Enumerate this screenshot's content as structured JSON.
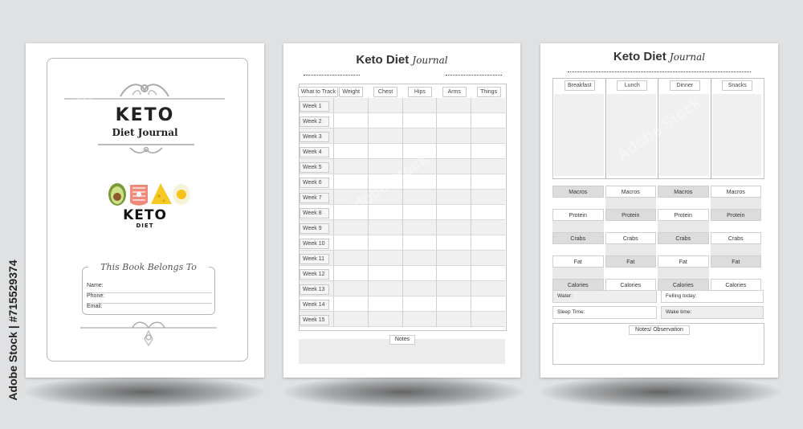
{
  "stock_label": "Adobe Stock | #715529374",
  "cover": {
    "title": "KETO",
    "subtitle": "Diet Journal",
    "logo_word": "KETO",
    "logo_sub": "DIET",
    "belongs_title": "This Book Belongs To",
    "fields": [
      "Name:",
      "Phone:",
      "Email:"
    ]
  },
  "tracker": {
    "title_main": "Keto Diet",
    "title_script": "Journal",
    "columns": [
      "What to Track",
      "Weight",
      "Chest",
      "Hips",
      "Arms",
      "Things"
    ],
    "weeks": [
      "Week 1",
      "Week 2",
      "Week 3",
      "Week 4",
      "Week 5",
      "Week 6",
      "Week 7",
      "Week 8",
      "Week 9",
      "Week 10",
      "Week 11",
      "Week 12",
      "Week 13",
      "Week 14",
      "Week 15"
    ],
    "notes_label": "Notes"
  },
  "daily": {
    "title_main": "Keto Diet",
    "title_script": "Journal",
    "meals": [
      "Breakfast",
      "Lunch",
      "Dinner",
      "Snacks"
    ],
    "macro_rows": [
      [
        "Macros",
        "Macros",
        "Macros",
        "Macros"
      ],
      [
        "Protein",
        "Protein",
        "Protein",
        "Protein"
      ],
      [
        "Crabs",
        "Crabs",
        "Crabs",
        "Crabs"
      ],
      [
        "Fat",
        "Fat",
        "Fat",
        "Fat"
      ],
      [
        "Calories",
        "Calories",
        "Calories",
        "Calories"
      ]
    ],
    "info": {
      "water": "Water:",
      "feeling": "Felling today:",
      "sleep": "Sleep Time:",
      "wake": "Wake time:"
    },
    "notes_label": "Notes/ Observation"
  },
  "colors": {
    "background": "#dfe1e3",
    "page": "#ffffff",
    "band": "#f0f0f0",
    "cell_gray": "#e3e3e3"
  }
}
